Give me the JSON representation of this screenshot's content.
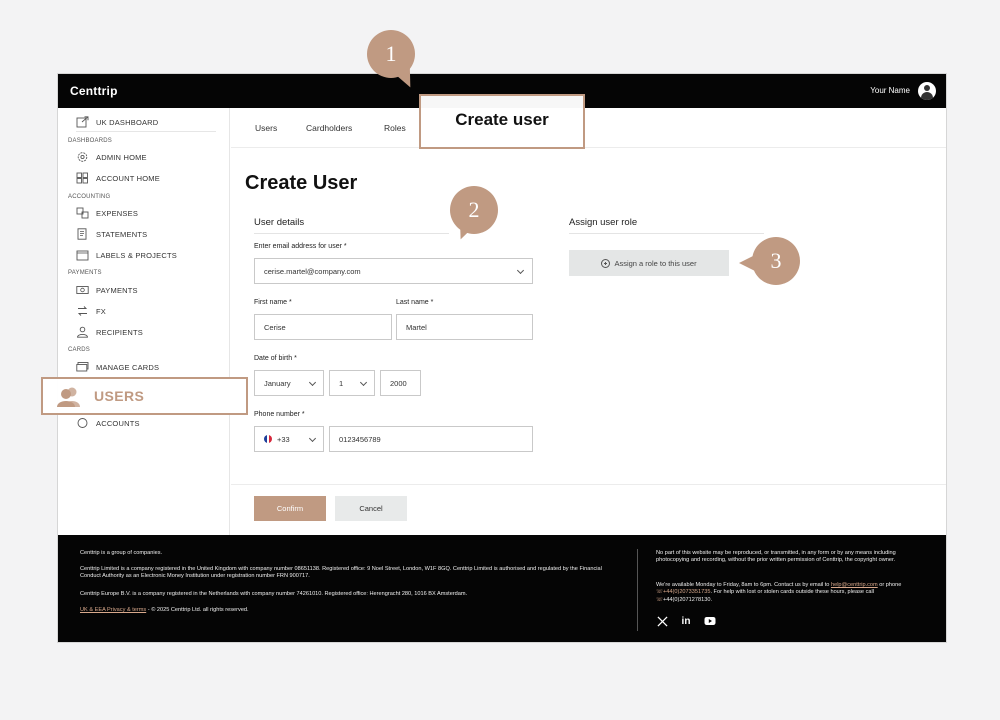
{
  "app": {
    "logo": "Centtrip",
    "user_name": "Your Name"
  },
  "sidebar": {
    "dashboard": "UK DASHBOARD",
    "sections": {
      "dashboards": "DASHBOARDS",
      "accounting": "ACCOUNTING",
      "payments": "PAYMENTS",
      "cards": "CARDS"
    },
    "items": {
      "admin_home": "ADMIN HOME",
      "account_home": "ACCOUNT HOME",
      "expenses": "EXPENSES",
      "statements": "STATEMENTS",
      "labels_projects": "LABELS & PROJECTS",
      "payments": "PAYMENTS",
      "fx": "FX",
      "recipients": "RECIPIENTS",
      "manage_cards": "MANAGE CARDS",
      "users": "USERS",
      "accounts": "ACCOUNTS"
    }
  },
  "tabs": [
    "Users",
    "Cardholders",
    "Roles",
    "Create user"
  ],
  "page": {
    "title": "Create User",
    "user_details_title": "User details",
    "assign_role_title": "Assign user role",
    "assign_role_button": "Assign a role to this user",
    "email_label": "Enter email address for user",
    "email_value": "cerise.martel@company.com",
    "first_name_label": "First name",
    "first_name_value": "Cerise",
    "last_name_label": "Last name",
    "last_name_value": "Martel",
    "dob_label": "Date of birth",
    "dob_month": "January",
    "dob_day": "1",
    "dob_year": "2000",
    "phone_label": "Phone number",
    "phone_code": "+33",
    "phone_value": "0123456789",
    "required_mark": "*",
    "confirm": "Confirm",
    "cancel": "Cancel"
  },
  "footer": {
    "line1": "Centtrip is a group of companies.",
    "line2": "Centtrip Limited is a company registered in the United Kingdom with company number 08651138. Registered office: 9 Noel Street, London, W1F 8GQ. Centtrip Limited is authorised and regulated by the Financial Conduct Authority as an Electronic Money Institution under registration number FRN 900717.",
    "line3": "Centtrip Europe B.V. is a company registered in the Netherlands with company number 74261010. Registered office: Herengracht 280, 1016 BX Amsterdam.",
    "privacy_link": "UK & EEA Privacy & terms",
    "copyright": " - © 2025 Centtrip Ltd. all rights reserved.",
    "right1": "No part of this website may be reproduced, or transmitted, in any form or by any means including photocopying and recording, without the prior written permission of Centtrip, the copyright owner.",
    "right2a": "We're available Monday to Friday, 8am to 6pm. Contact us by email to ",
    "email": "help@centtrip.com",
    "right2b": " or phone ",
    "phone1": "+44(0)2073351735",
    "right2c": ". For help with lost or stolen cards outside these hours, please call ",
    "phone2": "+44(0)2071278130",
    "right2d": "."
  },
  "annotations": {
    "callout_1": "1",
    "callout_2": "2",
    "callout_3": "3",
    "create_user_highlight": "Create user",
    "users_highlight": "USERS"
  },
  "colors": {
    "accent": "#c09a82",
    "topbar": "#050505",
    "flag_blue": "#1f3f9a",
    "flag_red": "#d6283c"
  }
}
